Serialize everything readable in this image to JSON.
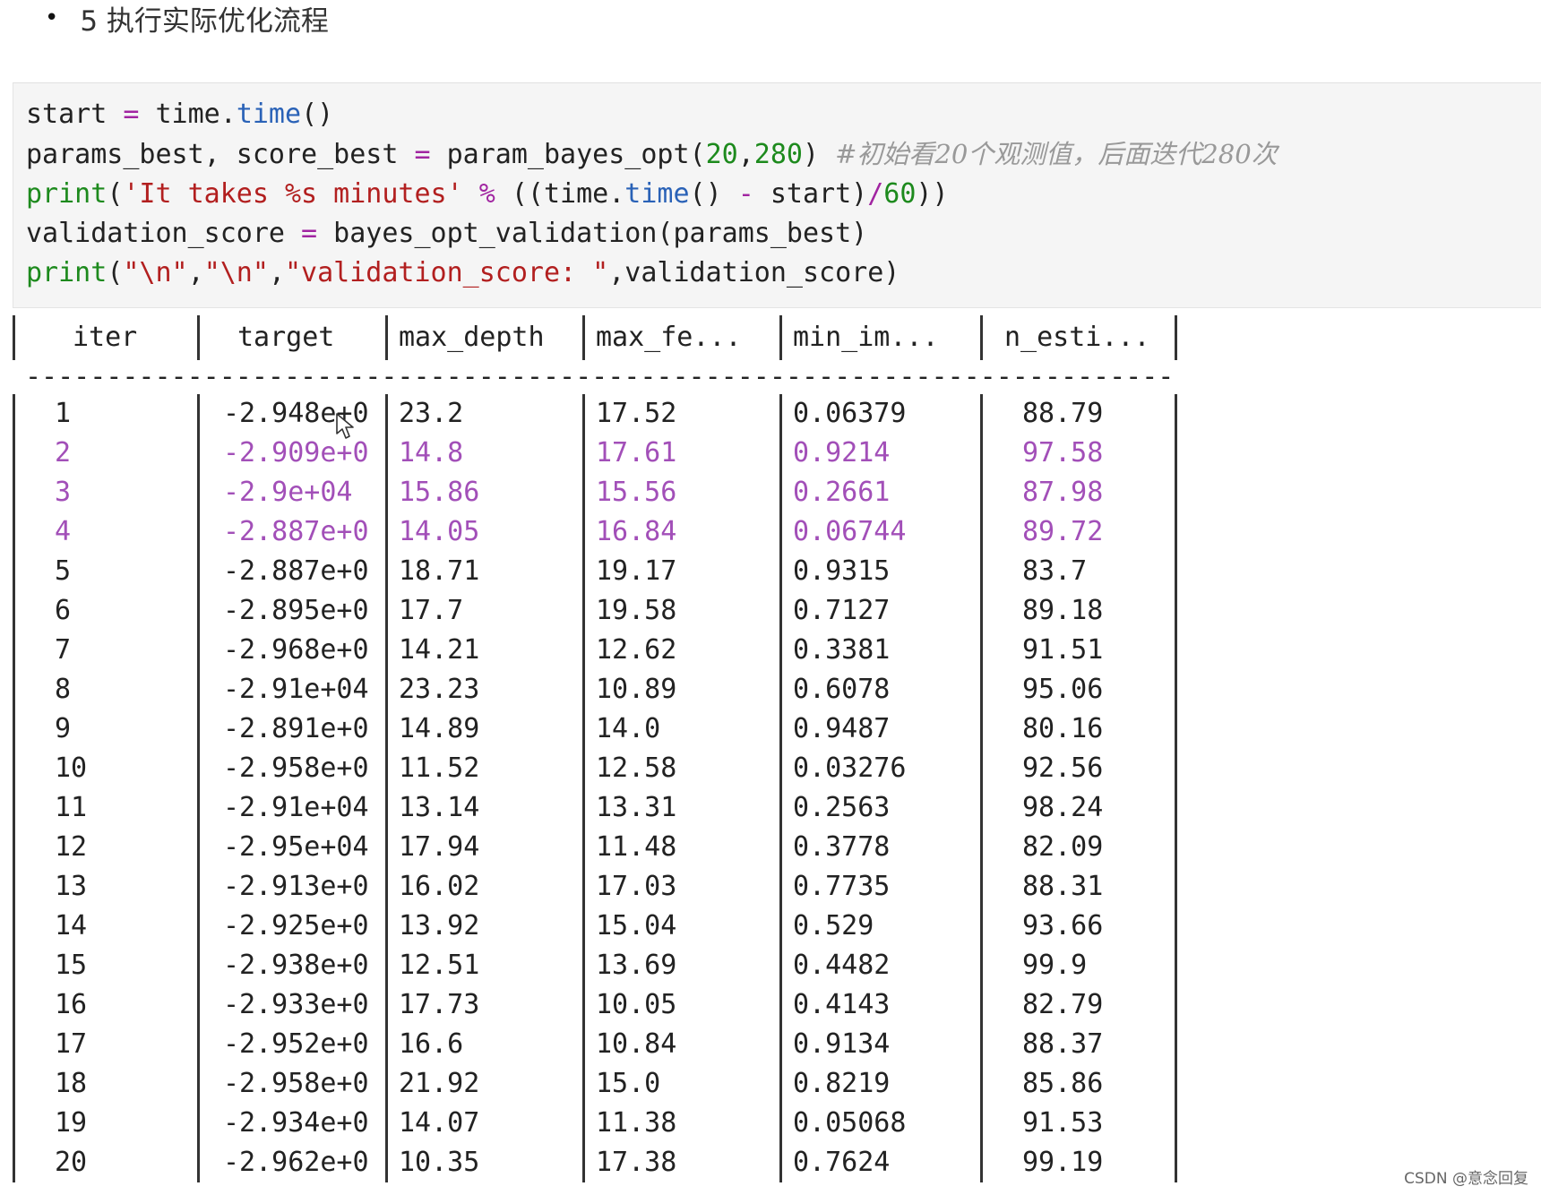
{
  "heading": {
    "bullet": "•",
    "text": "5 执行实际优化流程"
  },
  "code": {
    "line1": {
      "a": "start ",
      "eq": "=",
      "b": " time.",
      "call": "time",
      "c": "()"
    },
    "line2": {
      "a": "params_best, score_best ",
      "eq": "=",
      "b": " param_bayes_opt(",
      "n1": "20",
      "comma": ",",
      "n2": "280",
      "c": ") ",
      "comment": "#初始看20个观测值，后面迭代280次"
    },
    "line3": {
      "fn": "print",
      "p1": "(",
      "str": "'It takes %s minutes'",
      "sp": " ",
      "op": "%",
      "p2": " ((time.",
      "call": "time",
      "p3": "() ",
      "minus": "-",
      "p4": " start)",
      "slash": "/",
      "n": "60",
      "p5": "))"
    },
    "line4": {
      "a": "validation_score ",
      "eq": "=",
      "b": " bayes_opt_validation(params_best)"
    },
    "line5": {
      "fn": "print",
      "p1": "(",
      "s1": "\"\\n\"",
      "c1": ",",
      "s2": "\"\\n\"",
      "c2": ",",
      "s3": "\"validation_score: \"",
      "rest": ",validation_score)"
    }
  },
  "table": {
    "headers": [
      "iter",
      "target",
      "max_depth",
      "max_fe...",
      "min_im...",
      "n_esti..."
    ],
    "separator": "-------------------------------------------------------------------------",
    "rows": [
      {
        "iter": "1",
        "target": "-2.948e+0",
        "max_depth": "23.2",
        "max_fe": "17.52",
        "min_im": "0.06379",
        "n_esti": "88.79",
        "highlight": false
      },
      {
        "iter": "2",
        "target": "-2.909e+0",
        "max_depth": "14.8",
        "max_fe": "17.61",
        "min_im": "0.9214",
        "n_esti": "97.58",
        "highlight": true
      },
      {
        "iter": "3",
        "target": "-2.9e+04",
        "max_depth": "15.86",
        "max_fe": "15.56",
        "min_im": "0.2661",
        "n_esti": "87.98",
        "highlight": true
      },
      {
        "iter": "4",
        "target": "-2.887e+0",
        "max_depth": "14.05",
        "max_fe": "16.84",
        "min_im": "0.06744",
        "n_esti": "89.72",
        "highlight": true
      },
      {
        "iter": "5",
        "target": "-2.887e+0",
        "max_depth": "18.71",
        "max_fe": "19.17",
        "min_im": "0.9315",
        "n_esti": "83.7",
        "highlight": false
      },
      {
        "iter": "6",
        "target": "-2.895e+0",
        "max_depth": "17.7",
        "max_fe": "19.58",
        "min_im": "0.7127",
        "n_esti": "89.18",
        "highlight": false
      },
      {
        "iter": "7",
        "target": "-2.968e+0",
        "max_depth": "14.21",
        "max_fe": "12.62",
        "min_im": "0.3381",
        "n_esti": "91.51",
        "highlight": false
      },
      {
        "iter": "8",
        "target": "-2.91e+04",
        "max_depth": "23.23",
        "max_fe": "10.89",
        "min_im": "0.6078",
        "n_esti": "95.06",
        "highlight": false
      },
      {
        "iter": "9",
        "target": "-2.891e+0",
        "max_depth": "14.89",
        "max_fe": "14.0",
        "min_im": "0.9487",
        "n_esti": "80.16",
        "highlight": false
      },
      {
        "iter": "10",
        "target": "-2.958e+0",
        "max_depth": "11.52",
        "max_fe": "12.58",
        "min_im": "0.03276",
        "n_esti": "92.56",
        "highlight": false
      },
      {
        "iter": "11",
        "target": "-2.91e+04",
        "max_depth": "13.14",
        "max_fe": "13.31",
        "min_im": "0.2563",
        "n_esti": "98.24",
        "highlight": false
      },
      {
        "iter": "12",
        "target": "-2.95e+04",
        "max_depth": "17.94",
        "max_fe": "11.48",
        "min_im": "0.3778",
        "n_esti": "82.09",
        "highlight": false
      },
      {
        "iter": "13",
        "target": "-2.913e+0",
        "max_depth": "16.02",
        "max_fe": "17.03",
        "min_im": "0.7735",
        "n_esti": "88.31",
        "highlight": false
      },
      {
        "iter": "14",
        "target": "-2.925e+0",
        "max_depth": "13.92",
        "max_fe": "15.04",
        "min_im": "0.529",
        "n_esti": "93.66",
        "highlight": false
      },
      {
        "iter": "15",
        "target": "-2.938e+0",
        "max_depth": "12.51",
        "max_fe": "13.69",
        "min_im": "0.4482",
        "n_esti": "99.9",
        "highlight": false
      },
      {
        "iter": "16",
        "target": "-2.933e+0",
        "max_depth": "17.73",
        "max_fe": "10.05",
        "min_im": "0.4143",
        "n_esti": "82.79",
        "highlight": false
      },
      {
        "iter": "17",
        "target": "-2.952e+0",
        "max_depth": "16.6",
        "max_fe": "10.84",
        "min_im": "0.9134",
        "n_esti": "88.37",
        "highlight": false
      },
      {
        "iter": "18",
        "target": "-2.958e+0",
        "max_depth": "21.92",
        "max_fe": "15.0",
        "min_im": "0.8219",
        "n_esti": "85.86",
        "highlight": false
      },
      {
        "iter": "19",
        "target": "-2.934e+0",
        "max_depth": "14.07",
        "max_fe": "11.38",
        "min_im": "0.05068",
        "n_esti": "91.53",
        "highlight": false
      },
      {
        "iter": "20",
        "target": "-2.962e+0",
        "max_depth": "10.35",
        "max_fe": "17.38",
        "min_im": "0.7624",
        "n_esti": "99.19",
        "highlight": false
      }
    ]
  },
  "watermark": "CSDN @意念回复",
  "colors": {
    "highlight_row": "#a24fb8",
    "code_bg": "#f5f5f5"
  }
}
